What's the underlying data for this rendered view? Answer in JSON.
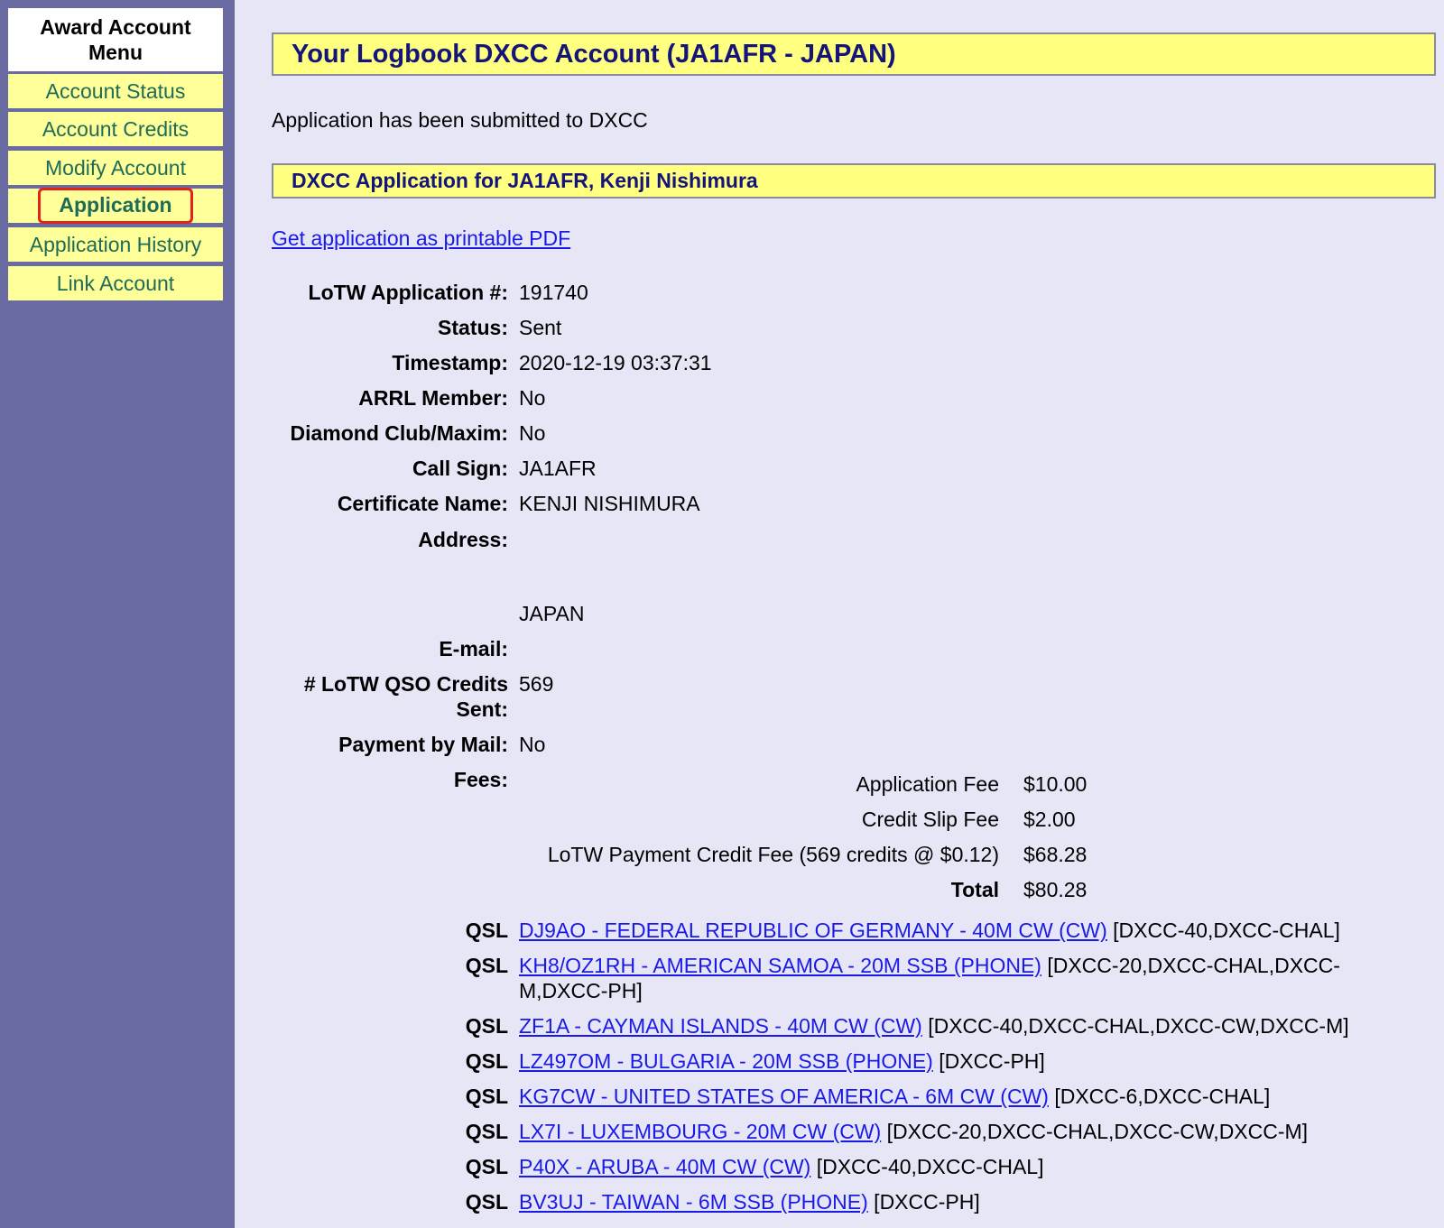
{
  "sidebar": {
    "title": "Award Account Menu",
    "items": [
      {
        "label": "Account Status"
      },
      {
        "label": "Account Credits"
      },
      {
        "label": "Modify Account"
      },
      {
        "label": "Application"
      },
      {
        "label": "Application History"
      },
      {
        "label": "Link Account"
      }
    ]
  },
  "page": {
    "title": "Your Logbook DXCC Account (JA1AFR - JAPAN)",
    "notice": "Application has been submitted to DXCC",
    "section_title": "DXCC Application for JA1AFR, Kenji Nishimura",
    "pdf_link": "Get application as printable PDF"
  },
  "details": {
    "app_no": {
      "label": "LoTW Application #:",
      "value": "191740"
    },
    "status": {
      "label": "Status:",
      "value": "Sent"
    },
    "timestamp": {
      "label": "Timestamp:",
      "value": "2020-12-19 03:37:31"
    },
    "arrl_member": {
      "label": "ARRL Member:",
      "value": "No"
    },
    "diamond_club": {
      "label": "Diamond Club/Maxim:",
      "value": "No"
    },
    "call_sign": {
      "label": "Call Sign:",
      "value": "JA1AFR"
    },
    "certificate_name": {
      "label": "Certificate Name:",
      "value": "KENJI NISHIMURA"
    },
    "address": {
      "label": "Address:",
      "value": "JAPAN"
    },
    "email": {
      "label": "E-mail:",
      "value": ""
    },
    "qso_credits": {
      "label_line1": "# LoTW QSO Credits",
      "label_line2": "Sent:",
      "value": "569"
    },
    "payment_by_mail": {
      "label": "Payment by Mail:",
      "value": "No"
    },
    "fees_label": "Fees:"
  },
  "fees": [
    {
      "label": "Application Fee",
      "amount": "$10.00"
    },
    {
      "label": "Credit Slip Fee",
      "amount": "$2.00"
    },
    {
      "label": "LoTW Payment Credit Fee (569 credits @ $0.12)",
      "amount": "$68.28"
    },
    {
      "label": "Total",
      "amount": "$80.28"
    }
  ],
  "qsl_label": "QSL",
  "qsls": [
    {
      "link": "DJ9AO - FEDERAL REPUBLIC OF GERMANY - 40M CW (CW)",
      "tags": " [DXCC-40,DXCC-CHAL]"
    },
    {
      "link": "KH8/OZ1RH - AMERICAN SAMOA - 20M SSB (PHONE)",
      "tags": " [DXCC-20,DXCC-CHAL,DXCC-M,DXCC-PH]"
    },
    {
      "link": "ZF1A - CAYMAN ISLANDS - 40M CW (CW)",
      "tags": " [DXCC-40,DXCC-CHAL,DXCC-CW,DXCC-M]"
    },
    {
      "link": "LZ497OM - BULGARIA - 20M SSB (PHONE)",
      "tags": " [DXCC-PH]"
    },
    {
      "link": "KG7CW - UNITED STATES OF AMERICA - 6M CW (CW)",
      "tags": " [DXCC-6,DXCC-CHAL]"
    },
    {
      "link": "LX7I - LUXEMBOURG - 20M CW (CW)",
      "tags": " [DXCC-20,DXCC-CHAL,DXCC-CW,DXCC-M]"
    },
    {
      "link": "P40X - ARUBA - 40M CW (CW)",
      "tags": " [DXCC-40,DXCC-CHAL]"
    },
    {
      "link": "BV3UJ - TAIWAN - 6M SSB (PHONE)",
      "tags": " [DXCC-PH]"
    }
  ]
}
